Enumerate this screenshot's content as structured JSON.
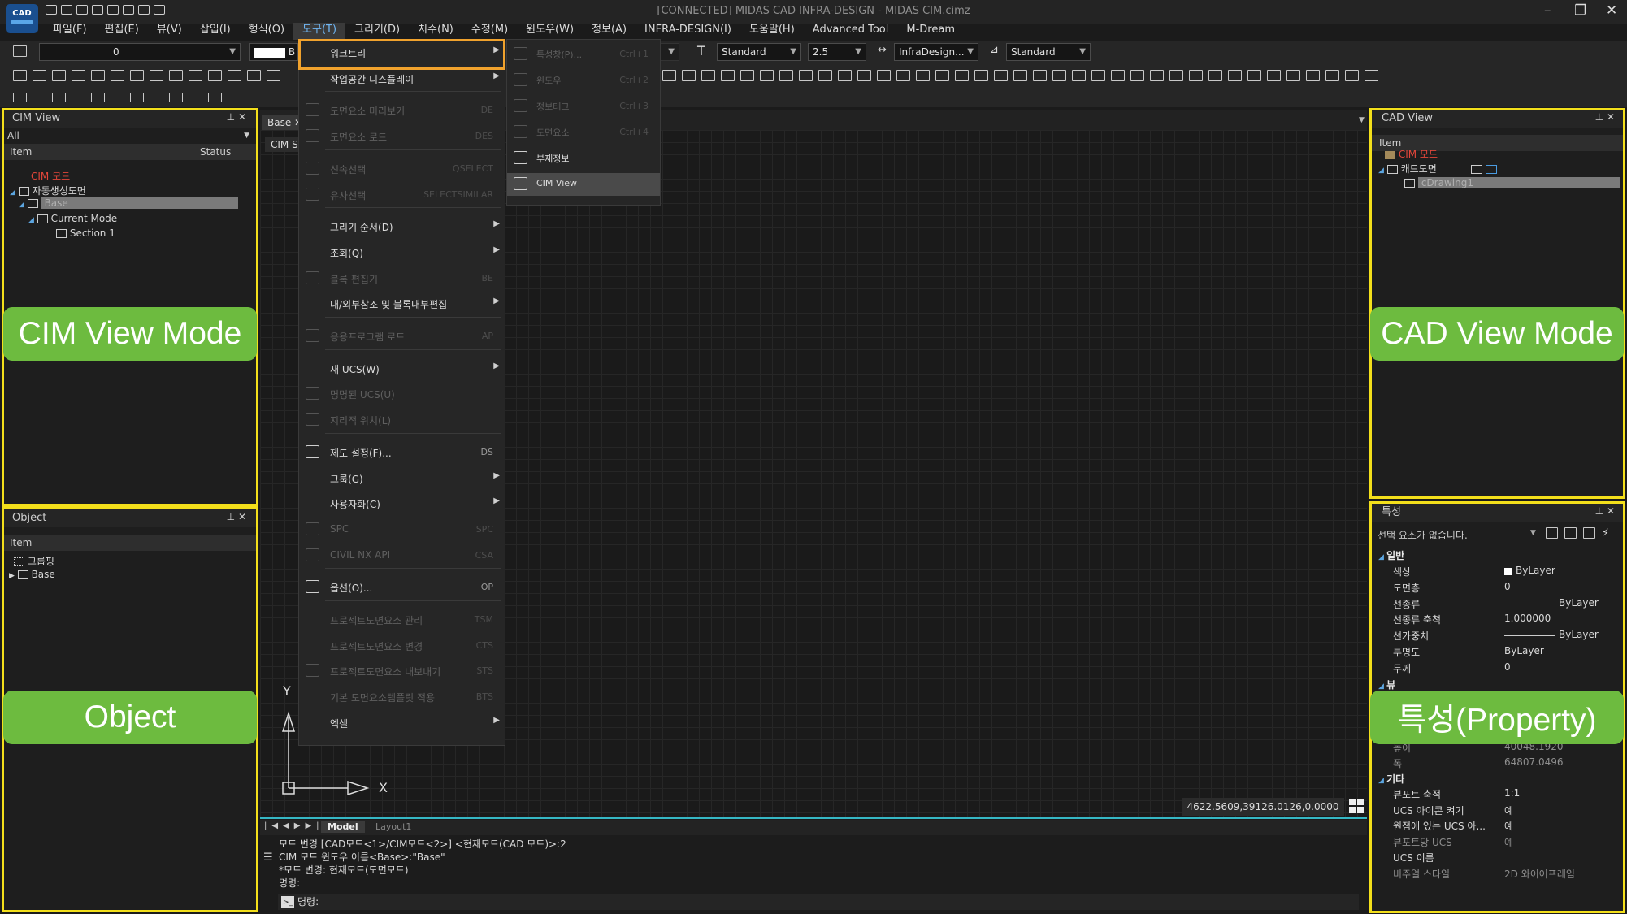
{
  "app": {
    "logo": "CAD",
    "title": "[CONNECTED] MIDAS CAD INFRA-DESIGN - MIDAS CIM.cimz",
    "window_controls": [
      "minimize-icon",
      "restore-icon",
      "close-icon"
    ]
  },
  "menubar": [
    "파일(F)",
    "편집(E)",
    "뷰(V)",
    "삽입(I)",
    "형식(O)",
    "도구(T)",
    "그리기(D)",
    "치수(N)",
    "수정(M)",
    "윈도우(W)",
    "정보(A)",
    "INFRA-DESIGN(I)",
    "도움말(H)",
    "Advanced Tool",
    "M-Dream"
  ],
  "toolbar": {
    "layer_value": "0",
    "color_value": "B",
    "text_style": "Standard",
    "text_height": "2.5",
    "dim_style": "InfraDesign...",
    "table_style": "Standard"
  },
  "tools_menu": [
    {
      "label": "워크트리",
      "arrow": true,
      "highlight": true
    },
    {
      "label": "작업공간 디스플레이",
      "arrow": true
    },
    {
      "label": "도면요소 미리보기",
      "shortcut": "DE",
      "disabled": true
    },
    {
      "label": "도면요소 로드",
      "shortcut": "DES",
      "disabled": true
    },
    {
      "label": "신속선택",
      "shortcut": "QSELECT",
      "disabled": true
    },
    {
      "label": "유사선택",
      "shortcut": "SELECTSIMILAR",
      "disabled": true
    },
    {
      "label": "그리기 순서(D)",
      "arrow": true
    },
    {
      "label": "조회(Q)",
      "arrow": true
    },
    {
      "label": "블록 편집기",
      "shortcut": "BE",
      "disabled": true
    },
    {
      "label": "내/외부참조 및 블록내부편집",
      "arrow": true
    },
    {
      "label": "응용프로그램 로드",
      "shortcut": "AP",
      "disabled": true
    },
    {
      "label": "새 UCS(W)",
      "arrow": true
    },
    {
      "label": "명명된 UCS(U)",
      "disabled": true
    },
    {
      "label": "지리적 위치(L)",
      "disabled": true
    },
    {
      "label": "제도 설정(F)...",
      "shortcut": "DS"
    },
    {
      "label": "그룹(G)",
      "arrow": true
    },
    {
      "label": "사용자화(C)",
      "arrow": true
    },
    {
      "label": "SPC",
      "shortcut": "SPC",
      "disabled": true
    },
    {
      "label": "CIVIL NX API",
      "shortcut": "CSA",
      "disabled": true
    },
    {
      "label": "옵션(O)...",
      "shortcut": "OP"
    },
    {
      "label": "프로젝트도면요소 관리",
      "shortcut": "TSM",
      "disabled": true
    },
    {
      "label": "프로젝트도면요소 변경",
      "shortcut": "CTS",
      "disabled": true
    },
    {
      "label": "프로젝트도면요소 내보내기",
      "shortcut": "STS",
      "disabled": true
    },
    {
      "label": "기본 도면요소템플릿 적용",
      "shortcut": "BTS",
      "disabled": true
    },
    {
      "label": "엑셀",
      "arrow": true
    }
  ],
  "worktree_submenu": [
    {
      "label": "특성창(P)...",
      "shortcut": "Ctrl+1",
      "disabled": true
    },
    {
      "label": "윈도우",
      "shortcut": "Ctrl+2",
      "disabled": true
    },
    {
      "label": "정보태그",
      "shortcut": "Ctrl+3",
      "disabled": true
    },
    {
      "label": "도면요소",
      "shortcut": "Ctrl+4",
      "disabled": true
    },
    {
      "label": "부재정보"
    },
    {
      "label": "CIM View",
      "selected": true
    }
  ],
  "cim_view": {
    "title": "CIM View",
    "filter": "All",
    "col_item": "Item",
    "col_status": "Status",
    "mode": "CIM 모드",
    "root": "자동생성도면",
    "base": "Base",
    "current": "Current Mode",
    "section": "Section 1"
  },
  "object_panel": {
    "title": "Object",
    "col_item": "Item",
    "group": "그룹핑",
    "base": "Base"
  },
  "cad_view": {
    "title": "CAD View",
    "col_item": "Item",
    "mode": "CIM 모드",
    "root": "캐드도면",
    "drawing": "cDrawing1"
  },
  "properties": {
    "title": "특성",
    "selection": "선택 요소가 없습니다.",
    "general": "일반",
    "rows": [
      [
        "색상",
        "ByLayer"
      ],
      [
        "도면층",
        "0"
      ],
      [
        "선종류",
        "ByLayer"
      ],
      [
        "선종류 축척",
        "1.000000"
      ],
      [
        "선가중치",
        "ByLayer"
      ],
      [
        "투명도",
        "ByLayer"
      ],
      [
        "두께",
        "0"
      ]
    ],
    "view": "뷰",
    "partial": [
      [
        "높이",
        "40048.1920"
      ],
      [
        "폭",
        "64807.0496"
      ]
    ],
    "misc": "기타",
    "misc_rows": [
      [
        "뷰포트 축적",
        "1:1"
      ],
      [
        "UCS 아이콘 켜기",
        "예"
      ],
      [
        "원점에 있는 UCS 아...",
        "예"
      ],
      [
        "뷰포트당 UCS",
        "예"
      ],
      [
        "UCS 이름",
        ""
      ],
      [
        "비주얼 스타일",
        "2D 와이어프레임"
      ]
    ]
  },
  "drawing": {
    "tab_base": "Base",
    "tab_cim": "CIM S",
    "axis_x": "X",
    "axis_y": "Y",
    "coords": "4622.5609,39126.0126,0.0000",
    "tab_model": "Model",
    "tab_layout": "Layout1"
  },
  "command": {
    "lines": [
      "모드 변경 [CAD모드<1>/CIM모드<2>] <현재모드(CAD 모드)>:2",
      "CIM 모드 윈도우 이름<Base>:\"Base\"",
      "*모드 변경: 현재모드(도면모드)",
      "명령:"
    ],
    "prompt": "명령:"
  },
  "callouts": {
    "cim": "CIM View Mode",
    "cad": "CAD View Mode",
    "object": "Object",
    "property": "특성(Property)"
  },
  "colors": {
    "highlight_box": "#f3df1b",
    "menu_box": "#f0a22d",
    "callout": "#6dbb3f",
    "accent": "#35b7c4"
  }
}
